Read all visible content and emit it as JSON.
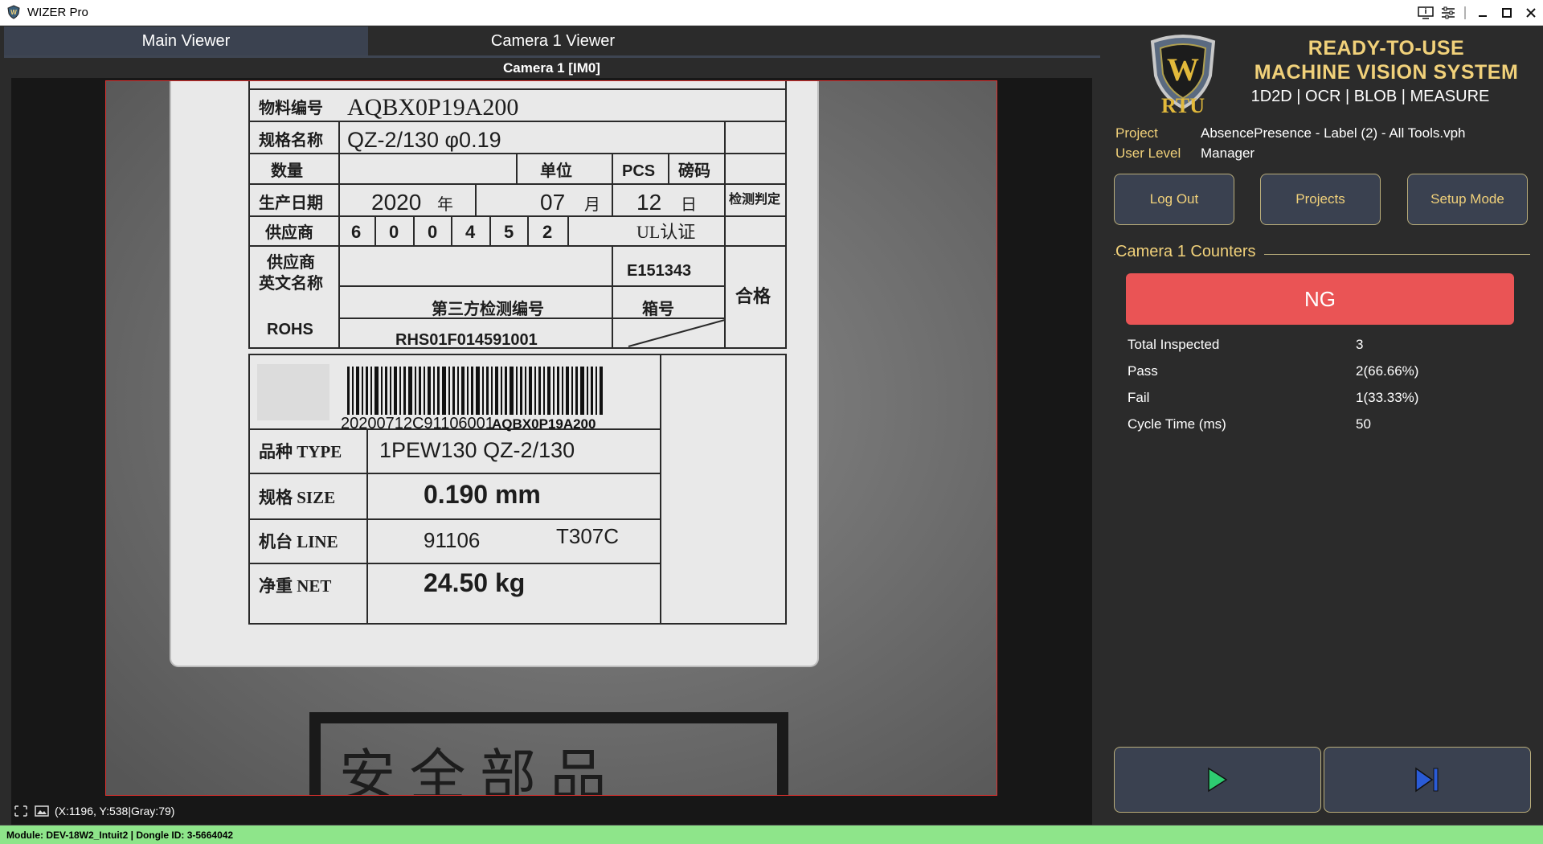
{
  "window": {
    "title": "WIZER Pro",
    "icons": [
      "app-shield-icon",
      "monitor-info-icon",
      "settings-sliders-icon",
      "minimize-icon",
      "maximize-icon",
      "close-icon"
    ]
  },
  "tabs": [
    {
      "label": "Main Viewer",
      "active": true
    },
    {
      "label": "Camera 1 Viewer",
      "active": false
    }
  ],
  "viewer": {
    "camera_title": "Camera 1  [IM0]",
    "coords": "(X:1196, Y:538|Gray:79)"
  },
  "label_image": {
    "part_no": "AQBX0P19A200",
    "spec": "QZ-2/130 φ0.19",
    "unit": "PCS",
    "year": "2020",
    "month": "07",
    "day": "12",
    "supplier_digits": [
      "6",
      "0",
      "0",
      "4",
      "5",
      "2"
    ],
    "ul": "UL认证",
    "ul_no": "E151343",
    "pass_mark": "合格",
    "rohs": "ROHS",
    "third_party": "第三方检测编号",
    "third_party_no": "RHS01F014591001",
    "box_no": "箱号",
    "barcode_text": "20200712C91106001",
    "barcode_part": "AQBX0P19A200",
    "type_label": "品种 TYPE",
    "type_value": "1PEW130  QZ-2/130",
    "size_label": "规格 SIZE",
    "size_value": "0.190  mm",
    "line_label": "机台 LINE",
    "line_value": "91106",
    "line_code": "T307C",
    "net_label": "净重 NET",
    "net_value": "24.50  kg",
    "row_labels": [
      "物料编号",
      "规格名称",
      "数量",
      "生产日期",
      "供应商",
      "供应商",
      "英文名称"
    ],
    "unit_label": "单位",
    "weight_label": "磅码",
    "inspect_label": "检测判定",
    "year_suffix": "年",
    "month_suffix": "月",
    "day_suffix": "日",
    "bottom_text": "安 全 部 品"
  },
  "brand": {
    "logo_text": "RTU",
    "line1": "READY-TO-USE",
    "line2": "MACHINE VISION SYSTEM",
    "line3": "1D2D | OCR | BLOB | MEASURE"
  },
  "project": {
    "project_label": "Project",
    "project_value": "AbsencePresence - Label (2) - All Tools.vph",
    "user_label": "User Level",
    "user_value": "Manager"
  },
  "buttons": {
    "logout": "Log Out",
    "projects": "Projects",
    "setup": "Setup Mode"
  },
  "counters": {
    "title": "Camera 1 Counters",
    "result": "NG",
    "result_color": "#ea5455",
    "rows": [
      {
        "label": "Total Inspected",
        "value": "3"
      },
      {
        "label": "Pass",
        "value": "2(66.66%)"
      },
      {
        "label": "Fail",
        "value": "1(33.33%)"
      },
      {
        "label": "Cycle Time (ms)",
        "value": "50"
      }
    ]
  },
  "controls": {
    "run_icon": "play-icon",
    "run_color": "#2ecc71",
    "step_icon": "step-forward-icon",
    "step_color": "#2a5bd7"
  },
  "status": {
    "text": "Module: DEV-18W2_Intuit2 | Dongle ID: 3-5664042",
    "color": "#8ee58a"
  }
}
